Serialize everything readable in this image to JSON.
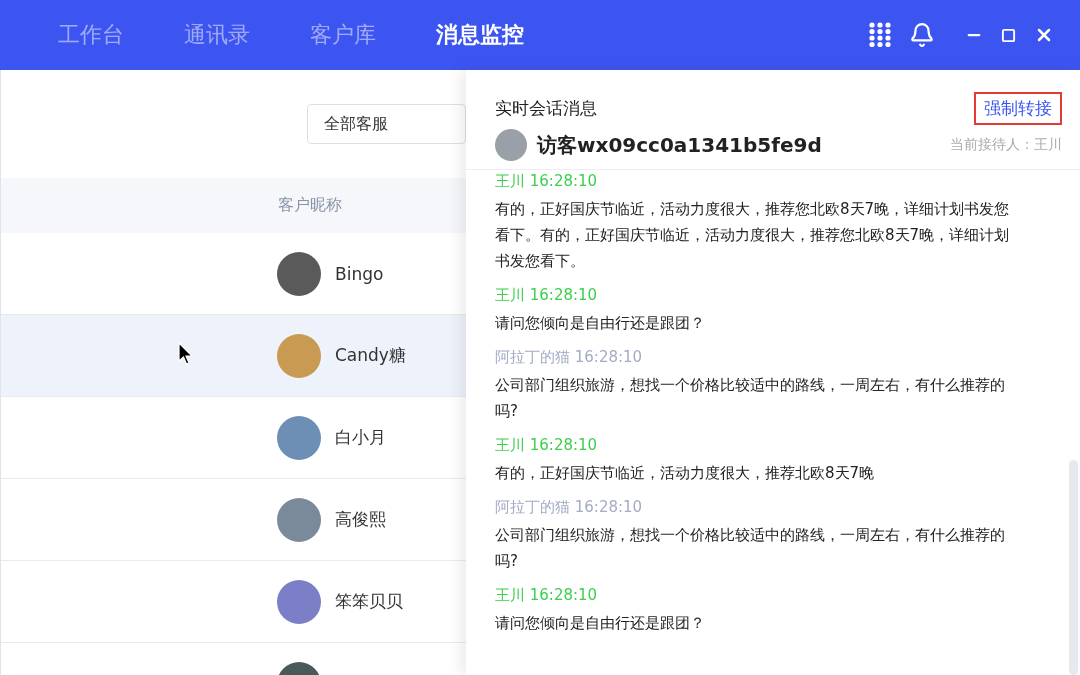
{
  "nav": {
    "tabs": [
      {
        "label": "工作台",
        "selected": false
      },
      {
        "label": "通讯录",
        "selected": false
      },
      {
        "label": "客户库",
        "selected": false
      },
      {
        "label": "消息监控",
        "selected": true
      }
    ]
  },
  "filter": {
    "value": "全部客服"
  },
  "table": {
    "columns": [
      "客户昵称"
    ],
    "rows": [
      {
        "name": "Bingo",
        "selected": false
      },
      {
        "name": "Candy糖",
        "selected": true
      },
      {
        "name": "白小月",
        "selected": false
      },
      {
        "name": "高俊熙",
        "selected": false
      },
      {
        "name": "笨笨贝贝",
        "selected": false
      },
      {
        "selected": false
      }
    ]
  },
  "chat": {
    "title": "实时会话消息",
    "action": "强制转接",
    "visitor": "访客wx09cc0a1341b5fe9d",
    "receiver": "当前接待人：王川",
    "messages": [
      {
        "kind": "agent",
        "sender": "王川 16:28:10",
        "text": "有的，正好国庆节临近，活动力度很大，推荐您北欧8天7晚，详细计划书发您看下。有的，正好国庆节临近，活动力度很大，推荐您北欧8天7晚，详细计划书发您看下。"
      },
      {
        "kind": "agent",
        "sender": "王川 16:28:10",
        "text": "请问您倾向是自由行还是跟团？"
      },
      {
        "kind": "visitor",
        "sender": "阿拉丁的猫 16:28:10",
        "text": "公司部门组织旅游，想找一个价格比较适中的路线，一周左右，有什么推荐的吗?"
      },
      {
        "kind": "agent",
        "sender": "王川 16:28:10",
        "text": "有的，正好国庆节临近，活动力度很大，推荐北欧8天7晚"
      },
      {
        "kind": "visitor",
        "sender": "阿拉丁的猫 16:28:10",
        "text": "公司部门组织旅游，想找一个价格比较适中的路线，一周左右，有什么推荐的吗?"
      },
      {
        "kind": "agent",
        "sender": "王川 16:28:10",
        "text": "请问您倾向是自由行还是跟团？"
      }
    ]
  }
}
